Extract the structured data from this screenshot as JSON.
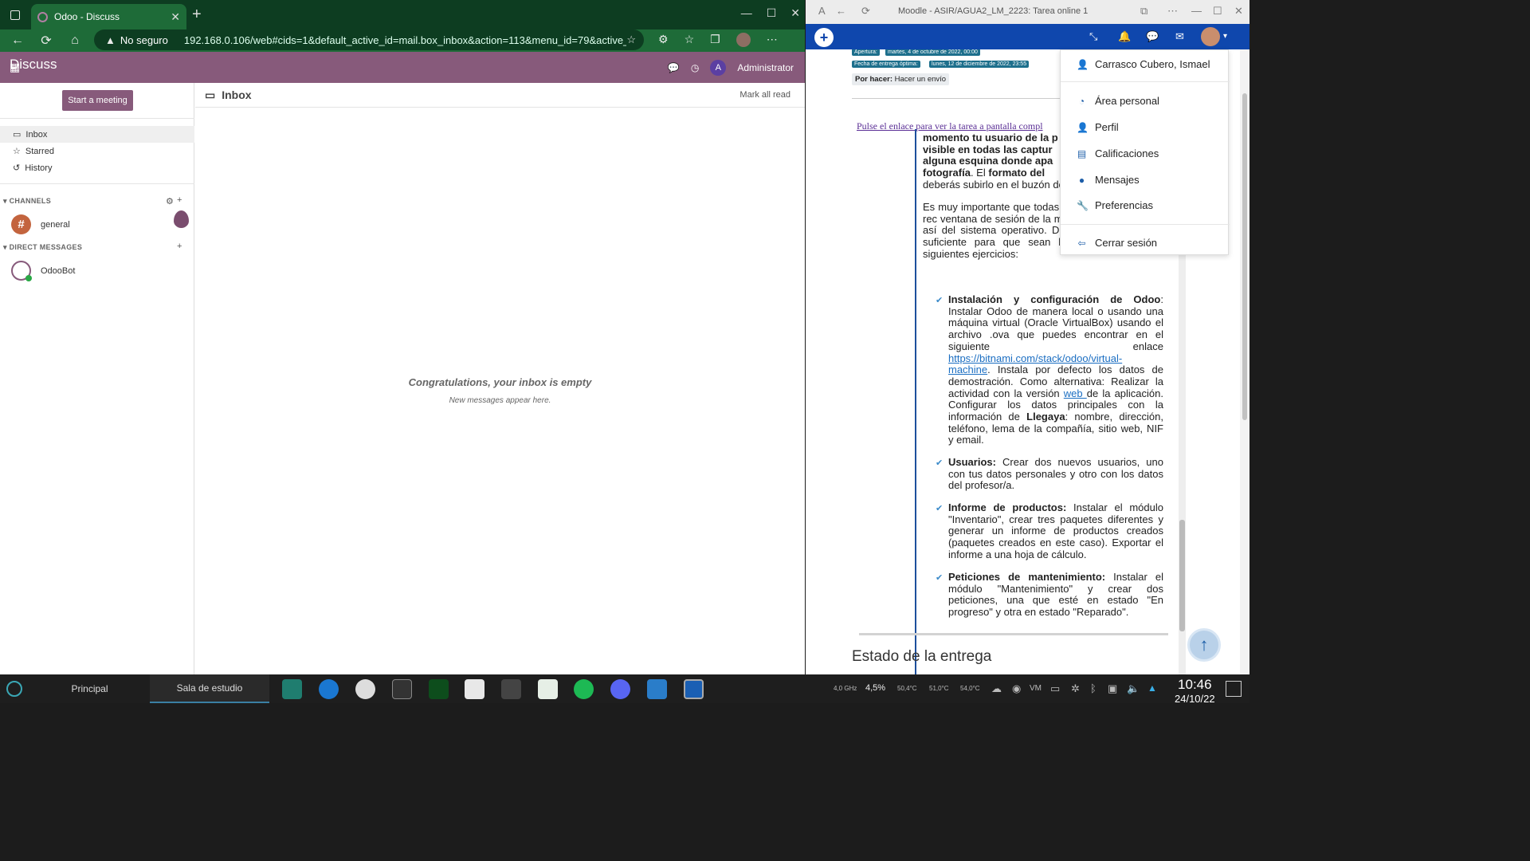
{
  "left_browser": {
    "tab_title": "Odoo - Discuss",
    "security": "No seguro",
    "url": "192.168.0.106/web#cids=1&default_active_id=mail.box_inbox&action=113&menu_id=79&active_id..."
  },
  "odoo": {
    "app_name": "Discuss",
    "user": "Administrator",
    "user_initial": "A",
    "start_meeting": "Start a meeting",
    "mailboxes": [
      "Inbox",
      "Starred",
      "History"
    ],
    "channels_header": "CHANNELS",
    "channels": [
      "general"
    ],
    "dm_header": "DIRECT MESSAGES",
    "direct_messages": [
      "OdooBot"
    ],
    "inbox_title": "Inbox",
    "mark_all_read": "Mark all read",
    "empty_title": "Congratulations, your inbox is empty",
    "empty_sub": "New messages appear here."
  },
  "right_browser": {
    "window_title": "Moodle - ASIR/AGUA2_LM_2223: Tarea online 1"
  },
  "moodle": {
    "apertura_label": "Apertura:",
    "apertura": "martes, 4 de octubre de 2022, 00:00",
    "entrega_label": "Fecha de entrega óptima:",
    "entrega": "lunes, 12 de diciembre de 2022, 23:55",
    "por_hacer_label": "Por hacer:",
    "por_hacer": "Hacer un envío",
    "link": "Pulse el enlace para ver la tarea a pantalla compl",
    "intro_lines": [
      "momento tu usuario de la p",
      "visible en todas las captur",
      "alguna esquina donde apa",
      "fotografía",
      ". El ",
      "formato del",
      "deberás subirlo en el buzón de"
    ],
    "para": "Es muy importante que todas pantalla completa, sin rec ventana de sesión de la mostrando vuestra foto, así del sistema operativo. Deben tener resolución suficiente para que sean legibles. Realizar los siguientes ejercicios:",
    "items": [
      {
        "title": "Instalación y configuración de Odoo",
        "text": ": Instalar Odoo de manera local o usando una máquina virtual (Oracle VirtualBox) usando el archivo .ova que puedes encontrar en el siguiente enlace ",
        "link": "https://bitnami.com/stack/odoo/virtual-machine",
        "text2": ". Instala por defecto los datos de demostración. Como alternativa: Realizar la actividad con la versión ",
        "link2": "web ",
        "text3": " de la aplicación. Configurar los datos principales con la información de ",
        "bold3": "Llegaya",
        "text4": ": nombre, dirección, teléfono, lema de la compañía, sitio web, NIF y email."
      },
      {
        "title": "Usuarios:",
        "text": " Crear dos nuevos usuarios, uno con tus datos personales y otro con los datos del profesor/a."
      },
      {
        "title": "Informe de productos:",
        "text": " Instalar el módulo \"Inventario\", crear tres paquetes diferentes y generar un informe de productos creados (paquetes creados en este caso). Exportar el informe a una hoja de cálculo."
      },
      {
        "title": "Peticiones de mantenimiento:",
        "text": " Instalar el módulo \"Mantenimiento\" y crear dos peticiones, una que esté en estado \"En progreso\" y otra en estado \"Reparado\"."
      }
    ],
    "estado": "Estado de la entrega",
    "user_menu": [
      "Carrasco Cubero, Ismael",
      "Área personal",
      "Perfil",
      "Calificaciones",
      "Mensajes",
      "Preferencias",
      "Cerrar sesión"
    ]
  },
  "taskbar": {
    "workspaces": [
      "Principal",
      "Sala de estudio"
    ],
    "cpu_freq": "4,0 GHz",
    "cpu_load": "4,5%",
    "temp1": "50,4°C",
    "temp2": "51,0°C",
    "temp3": "54,0°C",
    "time": "10:46",
    "date": "24/10/22"
  },
  "colors": {
    "odoo_purple": "#875a7b",
    "browser_green": "#1e6b38",
    "moodle_blue": "#0f47ad"
  }
}
